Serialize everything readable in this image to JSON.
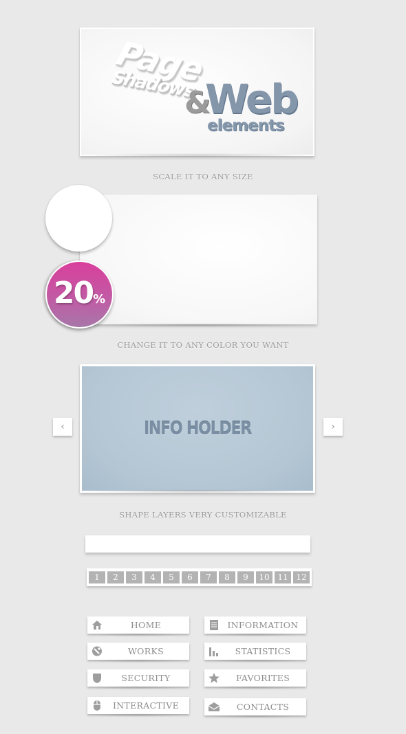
{
  "logo": {
    "word_page": "Page",
    "word_shadows": "Shadows",
    "ampersand": "&",
    "word_web": "Web",
    "word_elements": "elements",
    "colors": {
      "web": "#8496aa",
      "amp": "#9b9b9b"
    }
  },
  "captions": {
    "scale": "SCALE IT TO ANY SIZE",
    "color": "CHANGE IT TO ANY COLOR YOU WANT",
    "shape": "SHAPE LAYERS VERY CUSTOMIZABLE"
  },
  "badge": {
    "number": "20",
    "unit": "%",
    "colors": [
      "#d93f9c",
      "#a777a9"
    ]
  },
  "info_holder": {
    "label": "INFO HOLDER",
    "color": "#b4c6d4"
  },
  "slider_arrows": {
    "left_icon": "chevron-left-icon",
    "right_icon": "chevron-right-icon"
  },
  "input": {
    "value": "",
    "placeholder": ""
  },
  "pagination": [
    "1",
    "2",
    "3",
    "4",
    "5",
    "6",
    "7",
    "8",
    "9",
    "10",
    "11",
    "12"
  ],
  "nav": {
    "left": [
      {
        "label": "HOME",
        "icon": "home-icon"
      },
      {
        "label": "WORKS",
        "icon": "works-icon"
      },
      {
        "label": "SECURITY",
        "icon": "shield-icon"
      },
      {
        "label": "INTERACTIVE",
        "icon": "mouse-icon"
      }
    ],
    "right": [
      {
        "label": "INFORMATION",
        "icon": "document-icon"
      },
      {
        "label": "STATISTICS",
        "icon": "bar-chart-icon"
      },
      {
        "label": "FAVORITES",
        "icon": "star-icon"
      },
      {
        "label": "CONTACTS",
        "icon": "envelope-icon"
      }
    ]
  }
}
